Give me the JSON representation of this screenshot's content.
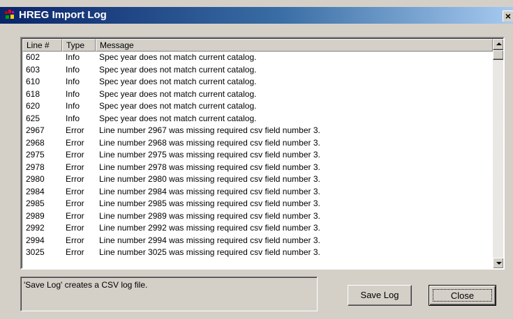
{
  "window": {
    "title": "HREG Import Log",
    "close_glyph": "×",
    "title_icon": "app-icon"
  },
  "list": {
    "columns": [
      "Line #",
      "Type",
      "Message"
    ],
    "rows": [
      {
        "line": "602",
        "type": "Info",
        "message": "Spec year does not match current catalog."
      },
      {
        "line": "603",
        "type": "Info",
        "message": "Spec year does not match current catalog."
      },
      {
        "line": "610",
        "type": "Info",
        "message": "Spec year does not match current catalog."
      },
      {
        "line": "618",
        "type": "Info",
        "message": "Spec year does not match current catalog."
      },
      {
        "line": "620",
        "type": "Info",
        "message": "Spec year does not match current catalog."
      },
      {
        "line": "625",
        "type": "Info",
        "message": "Spec year does not match current catalog."
      },
      {
        "line": "2967",
        "type": "Error",
        "message": "Line number 2967 was missing required csv field number 3."
      },
      {
        "line": "2968",
        "type": "Error",
        "message": "Line number 2968 was missing required csv field number 3."
      },
      {
        "line": "2975",
        "type": "Error",
        "message": "Line number 2975 was missing required csv field number 3."
      },
      {
        "line": "2978",
        "type": "Error",
        "message": "Line number 2978 was missing required csv field number 3."
      },
      {
        "line": "2980",
        "type": "Error",
        "message": "Line number 2980 was missing required csv field number 3."
      },
      {
        "line": "2984",
        "type": "Error",
        "message": "Line number 2984 was missing required csv field number 3."
      },
      {
        "line": "2985",
        "type": "Error",
        "message": "Line number 2985 was missing required csv field number 3."
      },
      {
        "line": "2989",
        "type": "Error",
        "message": "Line number 2989 was missing required csv field number 3."
      },
      {
        "line": "2992",
        "type": "Error",
        "message": "Line number 2992 was missing required csv field number 3."
      },
      {
        "line": "2994",
        "type": "Error",
        "message": "Line number 2994 was missing required csv field number 3."
      },
      {
        "line": "3025",
        "type": "Error",
        "message": "Line number 3025 was missing required csv field number 3."
      }
    ]
  },
  "status": {
    "text": "'Save Log' creates a CSV log file."
  },
  "buttons": {
    "save_label": "Save Log",
    "close_label": "Close"
  },
  "colors": {
    "titlebar_start": "#0a246a",
    "titlebar_end": "#a6caf0",
    "face": "#d4d0c8"
  }
}
